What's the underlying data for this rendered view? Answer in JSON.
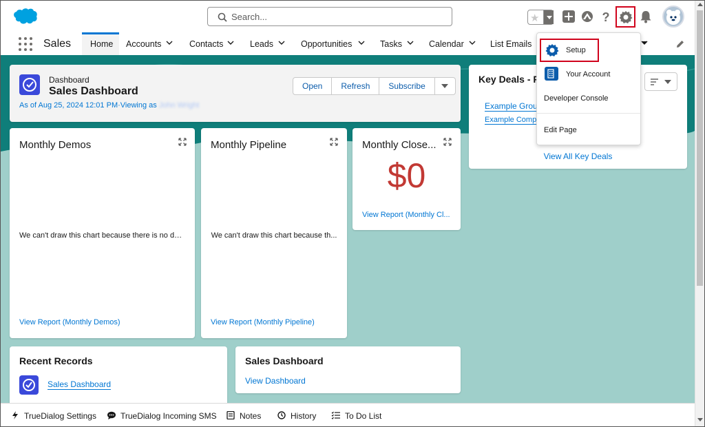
{
  "header": {
    "search_placeholder": "Search...",
    "icons": [
      "salesforce-logo",
      "favorites-star-icon",
      "add-icon",
      "trailhead-icon",
      "help-icon",
      "setup-gear-icon",
      "notifications-bell-icon",
      "avatar"
    ]
  },
  "nav": {
    "app_name": "Sales",
    "tabs": [
      {
        "label": "Home",
        "active": true,
        "chevron": false
      },
      {
        "label": "Accounts",
        "chevron": true
      },
      {
        "label": "Contacts",
        "chevron": true
      },
      {
        "label": "Leads",
        "chevron": true
      },
      {
        "label": "Opportunities",
        "chevron": true
      },
      {
        "label": "Tasks",
        "chevron": true
      },
      {
        "label": "Calendar",
        "chevron": true
      },
      {
        "label": "List Emails",
        "chevron": true
      }
    ]
  },
  "dashboard": {
    "kicker": "Dashboard",
    "title": "Sales Dashboard",
    "as_of": "As of Aug 25, 2024 12:01 PM·Viewing as",
    "viewing_as": "John Wright",
    "buttons": {
      "open": "Open",
      "refresh": "Refresh",
      "subscribe": "Subscribe"
    }
  },
  "widgets": {
    "demos": {
      "title": "Monthly Demos",
      "nodata": "We can't draw this chart because there is no data.",
      "link": "View Report (Monthly Demos)"
    },
    "pipeline": {
      "title": "Monthly Pipeline",
      "nodata": "We can't draw this chart because th...",
      "link": "View Report (Monthly Pipeline)"
    },
    "closed": {
      "title": "Monthly Close...",
      "value": "$0",
      "link": "View Report (Monthly Cl..."
    }
  },
  "key_deals": {
    "title": "Key Deals - R",
    "links": [
      "Example Group",
      "Example Compa"
    ],
    "view_all": "View All Key Deals"
  },
  "recent_records": {
    "title": "Recent Records",
    "items": [
      "Sales Dashboard"
    ]
  },
  "sales_dashboard_card": {
    "title": "Sales Dashboard",
    "link": "View Dashboard"
  },
  "setup_menu": {
    "items": [
      "Setup",
      "Your Account",
      "Developer Console",
      "Edit Page"
    ]
  },
  "utility_bar": {
    "items": [
      "TrueDialog Settings",
      "TrueDialog Incoming SMS",
      "Notes",
      "History",
      "To Do List"
    ]
  },
  "colors": {
    "brand_blue": "#0176d3",
    "teal_bg": "#9fcfca",
    "teal_pattern": "#0f7e7a",
    "highlight_red": "#d0021b",
    "value_red": "#c23934",
    "dashboard_icon": "#3a49da"
  }
}
